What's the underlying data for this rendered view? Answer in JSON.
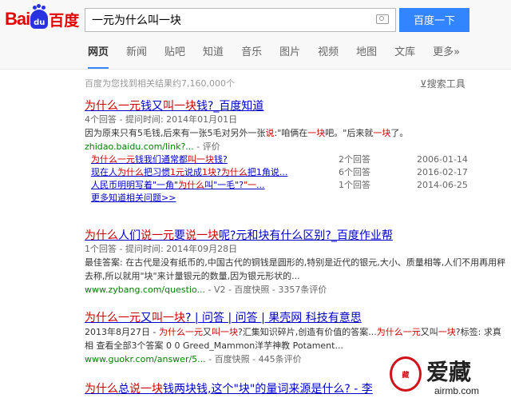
{
  "logo": {
    "part1": "Bai",
    "paw": "du",
    "part2": "百度"
  },
  "search": {
    "query": "一元为什么叫一块",
    "button_label": "百度一下"
  },
  "tabs": [
    {
      "label": "网页",
      "active": true
    },
    {
      "label": "新闻"
    },
    {
      "label": "贴吧"
    },
    {
      "label": "知道"
    },
    {
      "label": "音乐"
    },
    {
      "label": "图片"
    },
    {
      "label": "视频"
    },
    {
      "label": "地图"
    },
    {
      "label": "文库"
    },
    {
      "label": "更多»"
    }
  ],
  "stats": "百度为您找到相关结果约7,160,000个",
  "tools": "搜索工具",
  "results": [
    {
      "title": [
        {
          "t": "为什么一元",
          "em": true
        },
        {
          "t": "钱又"
        },
        {
          "t": "叫一块",
          "em": true
        },
        {
          "t": "钱?_百度知道"
        }
      ],
      "meta": "4个回答 - 提问时间: 2014年01月01日",
      "abstract": [
        {
          "t": "因为原来只有5毛钱,后来有一张5毛对另外一张"
        },
        {
          "t": "说",
          "em": true
        },
        {
          "t": ":\"咱俩在"
        },
        {
          "t": "一块",
          "em": true
        },
        {
          "t": "吧。\"后来就"
        },
        {
          "t": "一块",
          "em": true
        },
        {
          "t": "了。"
        }
      ],
      "url": "zhidao.baidu.com/link?...",
      "url_suffix": " - 评价",
      "sub": [
        {
          "q": [
            {
              "t": "为什么一元",
              "em": true
            },
            {
              "t": "钱我们通常都"
            },
            {
              "t": "叫一块",
              "em": true
            },
            {
              "t": "钱?"
            }
          ],
          "count": "2个回答",
          "date": "2006-01-14"
        },
        {
          "q": [
            {
              "t": "现在人"
            },
            {
              "t": "为什么",
              "em": true
            },
            {
              "t": "把习惯"
            },
            {
              "t": "1元",
              "em": true
            },
            {
              "t": "说成"
            },
            {
              "t": "1块",
              "em": true
            },
            {
              "t": "?"
            },
            {
              "t": "为什么",
              "em": true
            },
            {
              "t": "把1角说..."
            }
          ],
          "count": "6个回答",
          "date": "2016-02-17"
        },
        {
          "q": [
            {
              "t": "人民币明明写着\"一角\""
            },
            {
              "t": "为什么",
              "em": true
            },
            {
              "t": "叫\"一毛\"?"
            },
            {
              "t": "\"一",
              "em": true
            },
            {
              "t": "..."
            }
          ],
          "count": "1个回答",
          "date": "2014-06-25"
        }
      ],
      "more": "更多知道相关问题>>"
    },
    {
      "title": [
        {
          "t": "为什么",
          "em": true
        },
        {
          "t": "人们"
        },
        {
          "t": "说一元",
          "em": true
        },
        {
          "t": "要"
        },
        {
          "t": "说一块",
          "em": true
        },
        {
          "t": "呢?元和块有什么区别?_百度作业帮"
        }
      ],
      "meta": "1个回答 - 提问时间: 2014年09月28日",
      "abstract": [
        {
          "t": "最佳答案: 在古代是没有纸币的,中国古代的铜钱是圆形的,特别是近代的银元,大小、质量相等,人们不用再用秤去称,所以就用\"块\"来计量银元的数量,因为银元形状的..."
        }
      ],
      "url": "www.zybang.com/questio...",
      "url_suffix": " - V2 - 百度快照 - 3357条评价"
    },
    {
      "title": [
        {
          "t": "为什么一元",
          "em": true
        },
        {
          "t": "又"
        },
        {
          "t": "叫一块",
          "em": true
        },
        {
          "t": "? | 问答 | 问答 | 果壳网 科技有意思"
        }
      ],
      "abstract": [
        {
          "t": "2013年8月27日 - "
        },
        {
          "t": "为什么一元",
          "em": true
        },
        {
          "t": "又"
        },
        {
          "t": "叫一块",
          "em": true
        },
        {
          "t": "?汇集知识碎片,创造有价值的答案..."
        },
        {
          "t": "为什么一元",
          "em": true
        },
        {
          "t": "又叫"
        },
        {
          "t": "一块",
          "em": true
        },
        {
          "t": "?标签: 求真相 查看全部3个答案 0 0 Greed_Mammon洋芋神教 Potament..."
        }
      ],
      "url": "www.guokr.com/answer/5...",
      "url_suffix": " - 百度快照 - 445条评价"
    },
    {
      "title": [
        {
          "t": "为什么",
          "em": true
        },
        {
          "t": "总"
        },
        {
          "t": "说一块",
          "em": true
        },
        {
          "t": "钱两块钱,这个\"块\"的量词来源是什么? - 李"
        }
      ]
    }
  ],
  "watermark": {
    "seal": "藏",
    "text": "爱藏",
    "url": "airmb.com"
  }
}
